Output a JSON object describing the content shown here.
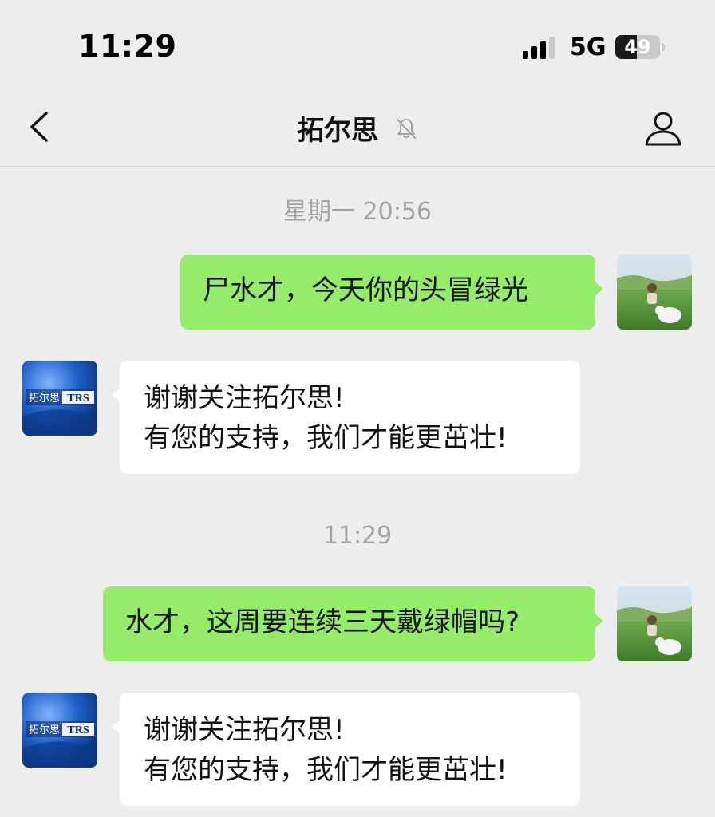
{
  "status_bar": {
    "time": "11:29",
    "network": "5G",
    "battery_level": "49",
    "battery_fraction": 0.49
  },
  "nav": {
    "back_icon": "chevron-left-icon",
    "title": "拓尔思",
    "mute_icon": "bell-muted-icon",
    "profile_icon": "person-icon"
  },
  "chat": {
    "timestamps": [
      "星期一 20:56",
      "11:29"
    ],
    "messages": [
      {
        "side": "sent",
        "text": "尸水才，今天你的头冒绿光"
      },
      {
        "side": "received",
        "lines": [
          "谢谢关注拓尔思!",
          "有您的支持，我们才能更茁壮!"
        ]
      },
      {
        "side": "sent",
        "text": "水才，这周要连续三天戴绿帽吗?"
      },
      {
        "side": "received",
        "lines": [
          "谢谢关注拓尔思!",
          "有您的支持，我们才能更茁壮!"
        ]
      }
    ],
    "brand_avatar_text": {
      "cn": "拓尔思",
      "en": "TRS"
    }
  },
  "colors": {
    "background": "#ededed",
    "sent_bubble": "#95ec69",
    "received_bubble": "#ffffff",
    "timestamp_text": "#a3a3a3"
  }
}
